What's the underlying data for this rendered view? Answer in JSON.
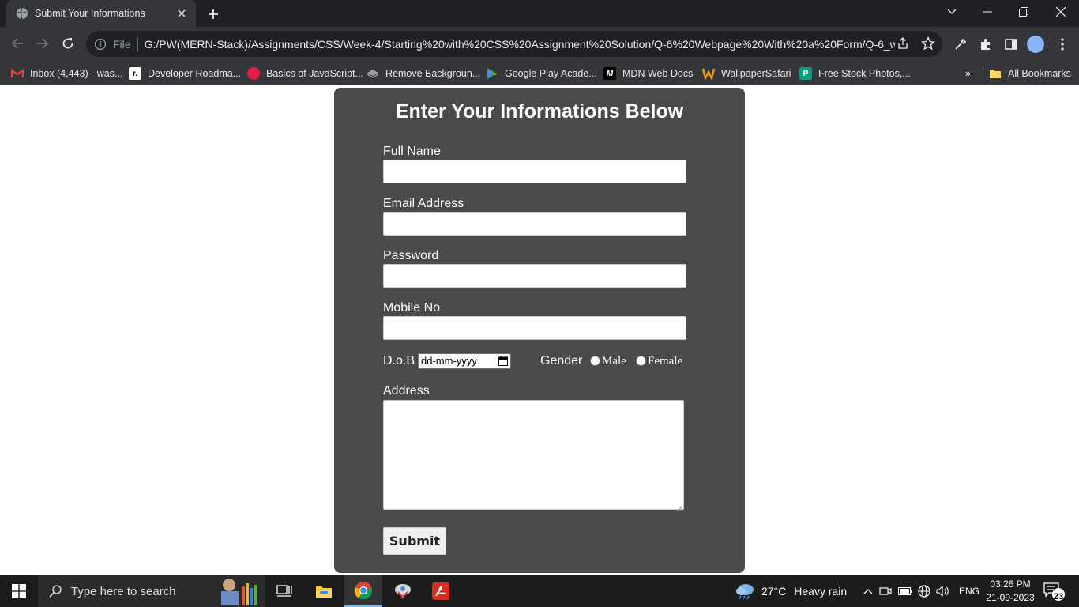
{
  "browser": {
    "tab": {
      "title": "Submit Your Informations"
    },
    "omnibox": {
      "scheme_label": "File",
      "url": "G:/PW(MERN-Stack)/Assignments/CSS/Week-4/Starting%20with%20CSS%20Assignment%20Solution/Q-6%20Webpage%20With%20a%20Form/Q-6_w..."
    },
    "bookmarks": [
      {
        "label": "Inbox (4,443) - was...",
        "icon": "gmail-icon",
        "color": "#ea4335"
      },
      {
        "label": "Developer Roadma...",
        "icon": "roadmap-icon",
        "color": "#000000"
      },
      {
        "label": "Basics of JavaScript...",
        "icon": "js-basics-icon",
        "color": "#e11d48"
      },
      {
        "label": "Remove Backgroun...",
        "icon": "remove-bg-icon",
        "color": "#9aa0a6"
      },
      {
        "label": "Google Play Acade...",
        "icon": "google-play-icon",
        "color": "#34a853"
      },
      {
        "label": "MDN Web Docs",
        "icon": "mdn-icon",
        "color": "#000000"
      },
      {
        "label": "WallpaperSafari",
        "icon": "wallpapersafari-icon",
        "color": "#f59e0b"
      },
      {
        "label": "Free Stock Photos,...",
        "icon": "stock-photos-icon",
        "color": "#05a081"
      }
    ],
    "all_bookmarks_label": "All Bookmarks",
    "more_bookmarks_label": "»"
  },
  "form": {
    "title": "Enter Your Informations Below",
    "full_name_label": "Full Name",
    "email_label": "Email Address",
    "password_label": "Password",
    "mobile_label": "Mobile No.",
    "dob_label": "D.o.B",
    "dob_placeholder": "dd-mm-yyyy",
    "gender_label": "Gender",
    "gender_options": [
      "Male",
      "Female"
    ],
    "address_label": "Address",
    "submit_label": "Submit"
  },
  "taskbar": {
    "search_placeholder": "Type here to search",
    "weather": {
      "temp": "27°C",
      "condition": "Heavy rain"
    },
    "language": "ENG",
    "time": "03:26 PM",
    "date": "21-09-2023",
    "notification_count": "23"
  },
  "colors": {
    "form_bg": "#4a4a4a",
    "chrome_dark": "#202124",
    "chrome_toolbar": "#35363a",
    "taskbar_bg": "#1c1c1c"
  }
}
